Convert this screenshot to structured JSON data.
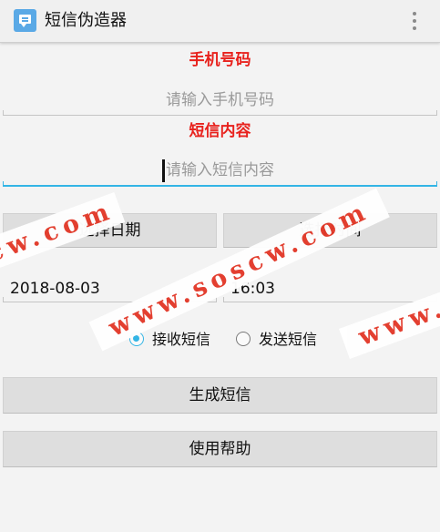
{
  "app_bar": {
    "title": "短信伪造器",
    "icon": "message-icon",
    "menu_icon": "overflow-menu-icon"
  },
  "phone": {
    "label": "手机号码",
    "placeholder": "请输入手机号码",
    "value": ""
  },
  "sms": {
    "label": "短信内容",
    "placeholder": "请输入短信内容",
    "value": ""
  },
  "date": {
    "button_label": "选择日期",
    "value": "2018-08-03"
  },
  "time": {
    "button_label": "选择时间",
    "value": "16:03"
  },
  "message_type": {
    "options": [
      {
        "label": "接收短信",
        "checked": true
      },
      {
        "label": "发送短信",
        "checked": false
      }
    ]
  },
  "actions": {
    "generate_label": "生成短信",
    "help_label": "使用帮助"
  },
  "watermarks": [
    "cw.com",
    "www.soscw.com",
    "www.s"
  ],
  "colors": {
    "label_red": "#e8221d",
    "accent_blue": "#33b5e5",
    "app_icon_blue": "#5aa9e6",
    "watermark_red": "#e33a2a"
  }
}
